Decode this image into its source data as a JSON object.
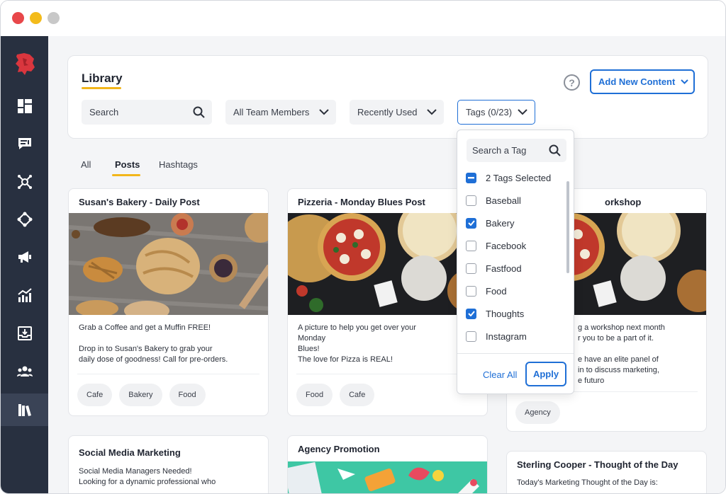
{
  "window": {
    "controls": [
      "close",
      "minimize",
      "maximize"
    ]
  },
  "sidebar": {
    "logo_icon": "red-logo-icon",
    "items": [
      {
        "icon": "dashboard-icon",
        "active": false
      },
      {
        "icon": "posts-icon",
        "active": false
      },
      {
        "icon": "network-icon",
        "active": false
      },
      {
        "icon": "move-icon",
        "active": false
      },
      {
        "icon": "megaphone-icon",
        "active": false
      },
      {
        "icon": "analytics-icon",
        "active": false
      },
      {
        "icon": "inbox-icon",
        "active": false
      },
      {
        "icon": "team-icon",
        "active": false
      },
      {
        "icon": "library-icon",
        "active": true
      }
    ]
  },
  "header": {
    "title": "Library",
    "help_label": "?",
    "add_button": "Add New Content"
  },
  "filters": {
    "search_placeholder": "Search",
    "team_members": "All Team Members",
    "sort": "Recently Used",
    "tags": "Tags (0/23)"
  },
  "tabs": [
    {
      "label": "All",
      "active": false
    },
    {
      "label": "Posts",
      "active": true
    },
    {
      "label": "Hashtags",
      "active": false
    }
  ],
  "cards": [
    {
      "title": "Susan's Bakery - Daily Post",
      "lines": [
        "Grab a Coffee and get a Muffin FREE!",
        "",
        "Drop in to Susan's Bakery to grab your",
        "daily dose of goodness! Call for pre-orders."
      ],
      "tags": [
        "Cafe",
        "Bakery",
        "Food"
      ]
    },
    {
      "title": "Pizzeria - Monday Blues Post",
      "lines": [
        "A picture to help you get over your",
        "Monday",
        "Blues!",
        "The love for Pizza is REAL!"
      ],
      "tags": [
        "Food",
        "Cafe"
      ]
    },
    {
      "title": "orkshop",
      "lines": [
        "g a workshop next month",
        "r you to be a part of it.",
        "",
        "e have an elite panel of",
        "in to discuss marketing,",
        "e futuro"
      ],
      "tags": [
        "Agency"
      ]
    },
    {
      "title": "Social Media Marketing",
      "lines": [
        "Social Media Managers Needed!",
        "Looking for a dynamic professional who"
      ]
    },
    {
      "title": "Agency Promotion"
    },
    {
      "title": "Sterling Cooper - Thought of the Day",
      "lines": [
        "Today's Marketing Thought of the Day is:"
      ]
    }
  ],
  "tag_dropdown": {
    "search_placeholder": "Search a Tag",
    "items": [
      {
        "label": "2 Tags Selected",
        "state": "indeterminate"
      },
      {
        "label": "Baseball",
        "state": "unchecked"
      },
      {
        "label": "Bakery",
        "state": "checked"
      },
      {
        "label": "Facebook",
        "state": "unchecked"
      },
      {
        "label": "Fastfood",
        "state": "unchecked"
      },
      {
        "label": "Food",
        "state": "unchecked"
      },
      {
        "label": "Thoughts",
        "state": "checked"
      },
      {
        "label": "Instagram",
        "state": "unchecked"
      }
    ],
    "clear_label": "Clear All",
    "apply_label": "Apply"
  },
  "colors": {
    "accent": "#1f6fd6",
    "underline": "#f2b61b",
    "sidebar": "#283040",
    "logo": "#d9363e"
  }
}
